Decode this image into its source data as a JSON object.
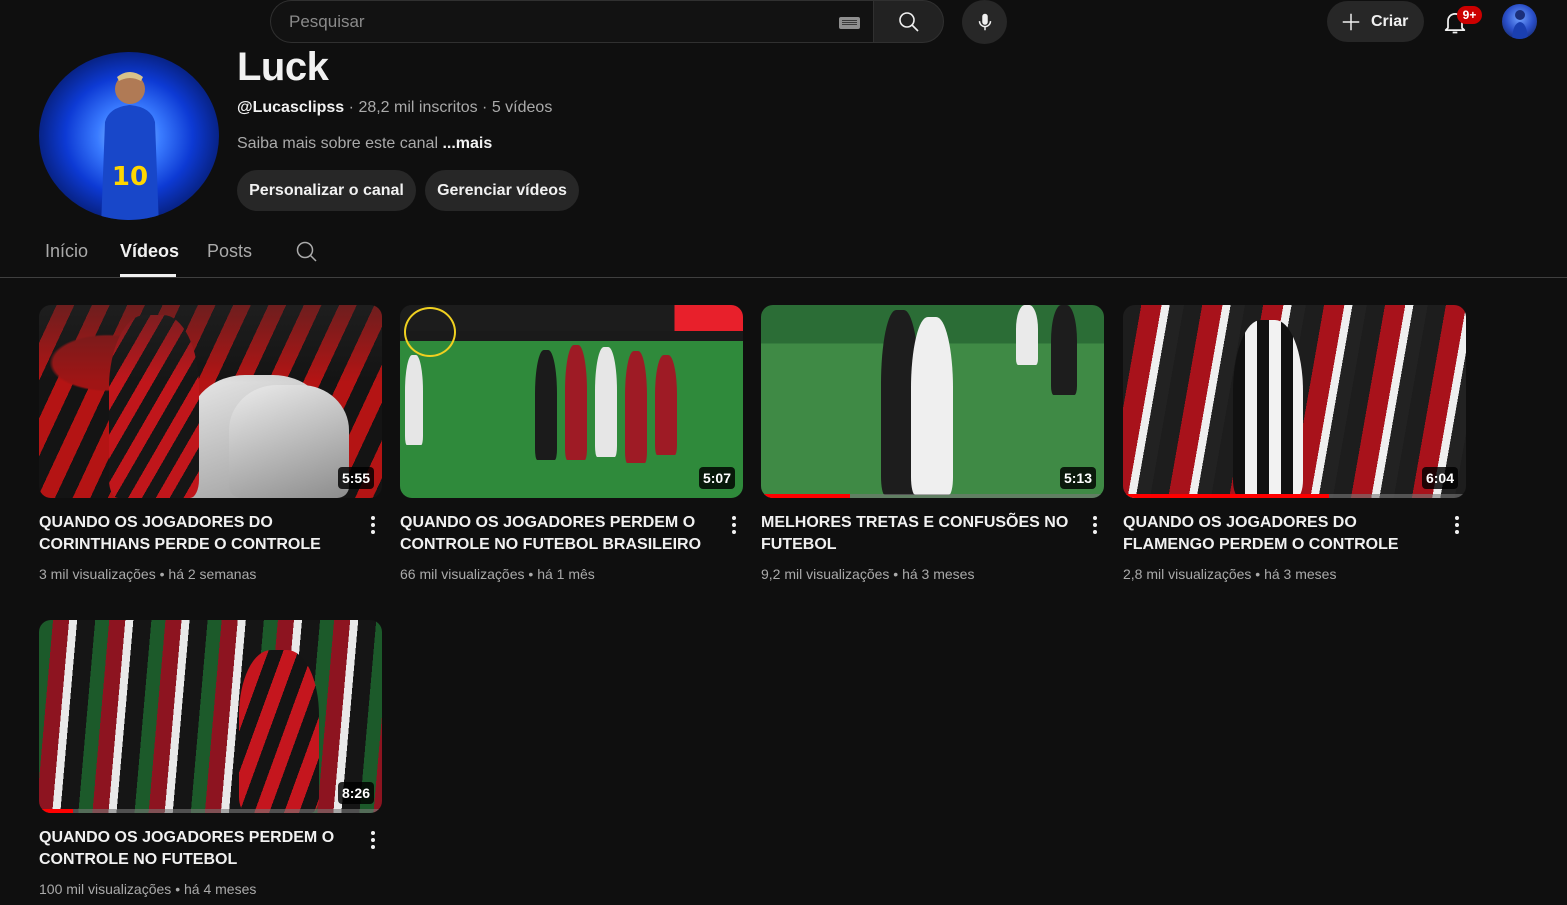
{
  "topbar": {
    "search_placeholder": "Pesquisar",
    "create_label": "Criar",
    "notifications_badge": "9+"
  },
  "channel": {
    "name": "Luck",
    "handle": "@Lucasclipss",
    "subscribers": "28,2 mil inscritos",
    "videos_count": "5 vídeos",
    "about": "Saiba mais sobre este canal",
    "more_label": "...mais",
    "customize_label": "Personalizar o canal",
    "manage_label": "Gerenciar vídeos"
  },
  "tabs": [
    {
      "label": "Início"
    },
    {
      "label": "Vídeos"
    },
    {
      "label": "Posts"
    }
  ],
  "videos": [
    {
      "title": "QUANDO OS JOGADORES DO CORINTHIANS PERDE O CONTROLE",
      "views": "3 mil visualizações",
      "age": "há 2 semanas",
      "duration": "5:55",
      "watched": 0
    },
    {
      "title": "QUANDO OS JOGADORES PERDEM O CONTROLE NO FUTEBOL BRASILEIRO",
      "views": "66 mil visualizações",
      "age": "há 1 mês",
      "duration": "5:07",
      "watched": 0
    },
    {
      "title": "MELHORES TRETAS E CONFUSÕES NO FUTEBOL",
      "views": "9,2 mil visualizações",
      "age": "há 3 meses",
      "duration": "5:13",
      "watched": 0.26
    },
    {
      "title": "QUANDO OS JOGADORES DO FLAMENGO PERDEM O CONTROLE",
      "views": "2,8 mil visualizações",
      "age": "há 3 meses",
      "duration": "6:04",
      "watched": 0.6
    },
    {
      "title": "QUANDO OS JOGADORES PERDEM O CONTROLE NO FUTEBOL",
      "views": "100 mil visualizações",
      "age": "há 4 meses",
      "duration": "8:26",
      "watched": 0.1
    }
  ],
  "meta_separator": "•",
  "colors": {
    "accent": "#ff0000",
    "background": "#0f0f0f",
    "badge": "#cc0000"
  }
}
